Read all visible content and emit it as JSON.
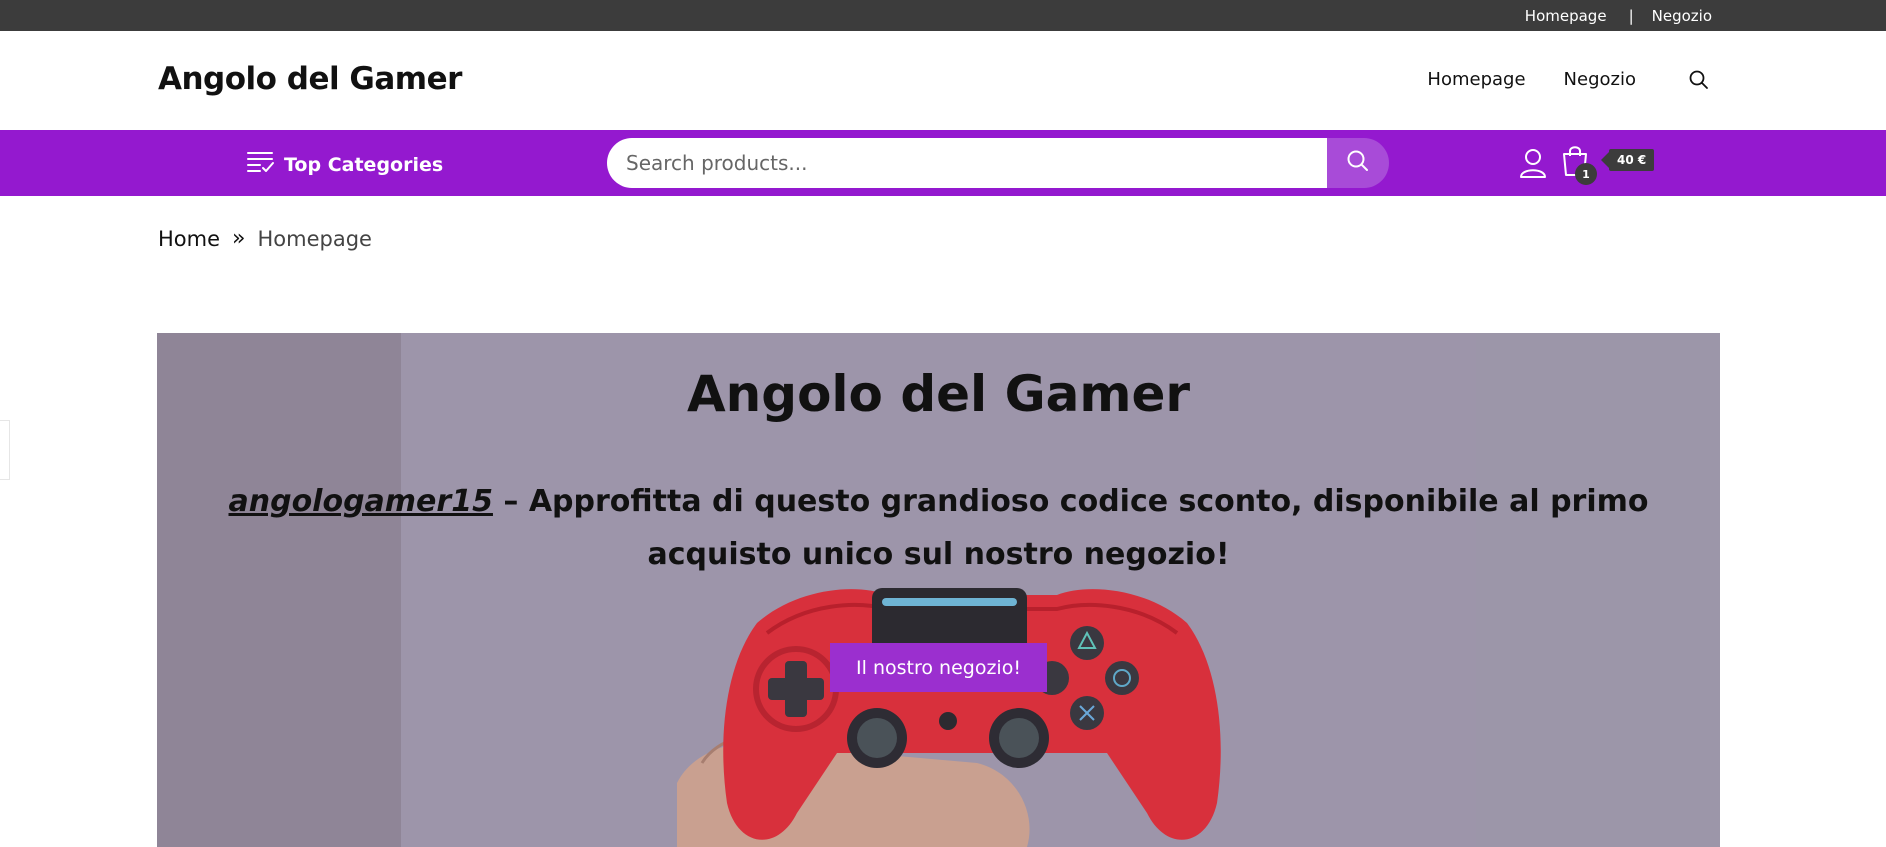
{
  "topbar": {
    "links": [
      "Homepage",
      "Negozio"
    ],
    "separator": "|"
  },
  "header": {
    "logo": "Angolo del Gamer",
    "nav": [
      "Homepage",
      "Negozio"
    ],
    "search_icon": "search-icon"
  },
  "purplebar": {
    "top_categories_label": "Top Categories",
    "top_categories_icon": "list-check-icon",
    "search_placeholder": "Search products...",
    "search_button_icon": "search-icon",
    "account_icon": "user-icon",
    "cart_icon": "shopping-bag-icon",
    "cart_count": "1",
    "cart_total": "40 €"
  },
  "breadcrumb": {
    "home": "Home",
    "separator": "»",
    "current": "Homepage"
  },
  "hero": {
    "title": "Angolo del Gamer",
    "promo_code": "angologamer15",
    "promo_text": " – Approfitta di questo grandioso codice sconto, disponibile al primo acquisto unico sul nostro negozio!",
    "button_label": "Il nostro negozio!",
    "image_subject": "red-game-controller-on-hand"
  },
  "colors": {
    "accent": "#9419cf",
    "button": "#9b2fcf",
    "topbar": "#3c3c3c"
  }
}
